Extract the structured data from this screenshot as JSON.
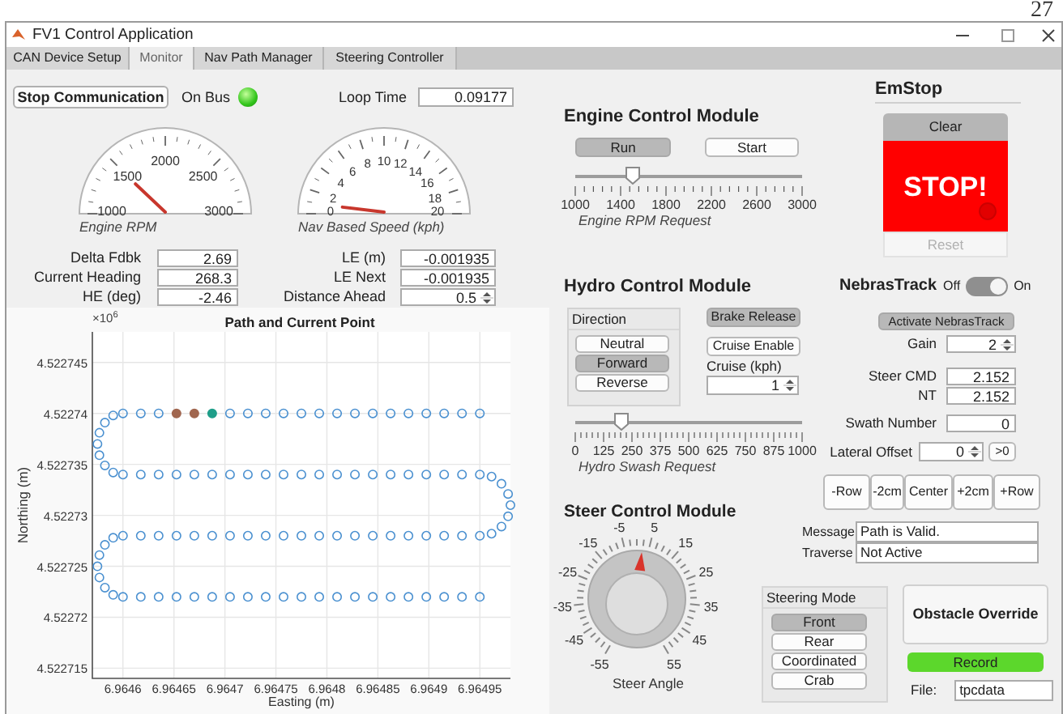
{
  "page_number": "27",
  "window": {
    "title": "FV1 Control Application"
  },
  "tabs": [
    {
      "label": "CAN Device Setup",
      "selected": false
    },
    {
      "label": "Monitor",
      "selected": true
    },
    {
      "label": "Nav Path Manager",
      "selected": false
    },
    {
      "label": "Steering Controller",
      "selected": false
    }
  ],
  "communication": {
    "button": "Stop Communication",
    "status_label": "On Bus",
    "on_bus": true,
    "loop_time_label": "Loop Time",
    "loop_time": "0.09177"
  },
  "gauges": [
    {
      "label": "Engine RPM",
      "ticks": [
        "1000",
        "1500",
        "2000",
        "2500",
        "3000"
      ]
    },
    {
      "label": "Nav Based Speed (kph)",
      "ticks": [
        "0",
        "2",
        "4",
        "6",
        "8",
        "10",
        "12",
        "14",
        "16",
        "18",
        "20"
      ]
    }
  ],
  "left_fields": [
    {
      "kind": "text",
      "label": "Delta Fdbk",
      "value": "2.69"
    },
    {
      "kind": "text",
      "label": "Current Heading",
      "value": "268.3"
    },
    {
      "kind": "text",
      "label": "HE (deg)",
      "value": "-2.46"
    }
  ],
  "right_fields": [
    {
      "kind": "text",
      "label": "LE (m)",
      "value": "-0.001935"
    },
    {
      "kind": "text",
      "label": "LE Next",
      "value": "-0.001935"
    },
    {
      "kind": "spinner",
      "label": "Distance Ahead",
      "value": "0.5"
    }
  ],
  "plot": {
    "y_exponent": "×10$^{6}$",
    "series_filled": [
      false,
      true,
      true
    ],
    "chart_data": {
      "type": "scatter",
      "title": "Path and Current Point",
      "xlabel": "Easting (m)",
      "ylabel": "Northing (m)",
      "grid": true,
      "xlim": [
        6.96457,
        6.96498
      ],
      "ylim": [
        4.522714,
        4.522748
      ],
      "xticks": [
        6.9646,
        6.96465,
        6.9647,
        6.96475,
        6.9648,
        6.96485,
        6.9649,
        6.96495
      ],
      "yticks": [
        4.522715,
        4.52272,
        4.522725,
        4.52273,
        4.522735,
        4.52274,
        4.522745
      ],
      "series": [
        {
          "color": "#4a90d0",
          "marker": "circle",
          "x": [
            6.9646175,
            6.964635,
            6.964705,
            6.9647225,
            6.96474,
            6.9647575,
            6.964775,
            6.9647925,
            6.96481,
            6.9648275,
            6.964845,
            6.9648625,
            6.96488,
            6.9648975,
            6.964915,
            6.9649325,
            6.96495,
            6.9646,
            6.9645904,
            6.9645823,
            6.9645769,
            6.964575,
            6.9645769,
            6.9645823,
            6.9645904,
            6.9646,
            6.9646175,
            6.964635,
            6.9646525,
            6.96467,
            6.9646875,
            6.964705,
            6.9647225,
            6.96474,
            6.9647575,
            6.964775,
            6.9647925,
            6.96481,
            6.9648275,
            6.964845,
            6.9648625,
            6.96488,
            6.9648975,
            6.964915,
            6.9649325,
            6.96495,
            6.9649615,
            6.9649712,
            6.9649777,
            6.96498,
            6.9649777,
            6.9649712,
            6.9649615,
            6.9646175,
            6.964635,
            6.9646525,
            6.96467,
            6.9646875,
            6.964705,
            6.9647225,
            6.96474,
            6.9647575,
            6.964775,
            6.9647925,
            6.96481,
            6.9648275,
            6.964845,
            6.9648625,
            6.96488,
            6.9648975,
            6.964915,
            6.9649325,
            6.96495,
            6.9646,
            6.9645904,
            6.9645823,
            6.9645769,
            6.964575,
            6.9645769,
            6.9645823,
            6.9645904,
            6.9646,
            6.9646175,
            6.964635,
            6.9646525,
            6.96467,
            6.9646875,
            6.964705,
            6.9647225,
            6.96474,
            6.9647575,
            6.964775,
            6.9647925,
            6.96481,
            6.9648275,
            6.964845,
            6.9648625,
            6.96488,
            6.9648975,
            6.964915,
            6.9649325,
            6.96495
          ],
          "values": [
            4.52274,
            4.52274,
            4.52274,
            4.52274,
            4.52274,
            4.52274,
            4.52274,
            4.52274,
            4.52274,
            4.52274,
            4.52274,
            4.52274,
            4.52274,
            4.52274,
            4.52274,
            4.52274,
            4.52274,
            4.52274,
            4.5227398,
            4.5227391,
            4.5227381,
            4.522737,
            4.5227359,
            4.5227349,
            4.5227342,
            4.522734,
            4.522734,
            4.522734,
            4.522734,
            4.522734,
            4.522734,
            4.522734,
            4.522734,
            4.522734,
            4.522734,
            4.522734,
            4.522734,
            4.522734,
            4.522734,
            4.522734,
            4.522734,
            4.522734,
            4.522734,
            4.522734,
            4.522734,
            4.522734,
            4.5227338,
            4.5227331,
            4.5227321,
            4.522731,
            4.5227299,
            4.5227289,
            4.5227282,
            4.522728,
            4.522728,
            4.522728,
            4.522728,
            4.522728,
            4.522728,
            4.522728,
            4.522728,
            4.522728,
            4.522728,
            4.522728,
            4.522728,
            4.522728,
            4.522728,
            4.522728,
            4.522728,
            4.522728,
            4.522728,
            4.522728,
            4.522728,
            4.522728,
            4.5227278,
            4.5227271,
            4.5227261,
            4.522725,
            4.5227239,
            4.5227229,
            4.5227222,
            4.522722,
            4.522722,
            4.522722,
            4.522722,
            4.522722,
            4.522722,
            4.522722,
            4.522722,
            4.522722,
            4.522722,
            4.522722,
            4.522722,
            4.522722,
            4.522722,
            4.522722,
            4.522722,
            4.522722,
            4.522722,
            4.522722,
            4.522722,
            4.522722
          ]
        },
        {
          "color": "#a0664f",
          "marker": "circle",
          "x": [
            6.9646525,
            6.96467
          ],
          "values": [
            4.52274,
            4.52274
          ]
        },
        {
          "color": "#1f9e89",
          "marker": "circle",
          "x": [
            6.9646875
          ],
          "values": [
            4.52274
          ]
        }
      ]
    }
  },
  "engine": {
    "title": "Engine Control Module",
    "buttons": [
      {
        "label": "Run",
        "selected": true
      },
      {
        "label": "Start",
        "selected": false
      }
    ],
    "slider": {
      "ticks": [
        "1000",
        "1400",
        "1800",
        "2200",
        "2600",
        "3000"
      ],
      "level": 0.25,
      "label": "Engine RPM Request"
    }
  },
  "emstop": {
    "title": "EmStop",
    "clear": "Clear",
    "stop": "STOP!",
    "reset": {
      "label": "Reset",
      "disabled": true
    }
  },
  "hydro": {
    "title": "Hydro Control Module",
    "direction": {
      "title": "Direction",
      "options": [
        {
          "label": "Neutral",
          "selected": false
        },
        {
          "label": "Forward",
          "selected": true
        },
        {
          "label": "Reverse",
          "selected": false
        }
      ]
    },
    "buttons": [
      {
        "label": "Brake Release",
        "selected": true
      },
      {
        "label": "Cruise Enable",
        "selected": false
      }
    ],
    "cruise_label": "Cruise (kph)",
    "cruise_value": "1",
    "slider": {
      "ticks": [
        "0",
        "125",
        "250",
        "375",
        "500",
        "625",
        "750",
        "875",
        "1000"
      ],
      "level": 0.2,
      "label": "Hydro Swash Request"
    }
  },
  "nebras": {
    "title": "NebrasTrack",
    "toggle": {
      "off_label": "Off",
      "on_label": "On",
      "on": true
    },
    "activate": {
      "label": "Activate NebrasTrack",
      "selected": true
    },
    "fields": [
      {
        "kind": "spinner",
        "label": "Gain",
        "value": "2"
      },
      {
        "kind": "text",
        "label": "Steer CMD",
        "value": "2.152"
      },
      {
        "kind": "text",
        "label": "NT",
        "value": "2.152"
      },
      {
        "kind": "text",
        "label": "Swath Number",
        "value": "0"
      },
      {
        "kind": "spinner_button",
        "label": "Lateral Offset",
        "value": "0",
        "button": ">0"
      }
    ],
    "offset_buttons": [
      "-Row",
      "-2cm",
      "Center",
      "+2cm",
      "+Row"
    ],
    "status": [
      {
        "label": "Message",
        "value": "Path is Valid."
      },
      {
        "label": "Traverse",
        "value": "Not Active"
      }
    ]
  },
  "steer": {
    "title": "Steer Control Module",
    "knob": {
      "ticks": [
        "-55",
        "-45",
        "-35",
        "-25",
        "-15",
        "-5",
        "5",
        "15",
        "25",
        "35",
        "45",
        "55"
      ],
      "label": "Steer Angle"
    }
  },
  "steering_mode": {
    "title": "Steering Mode",
    "options": [
      {
        "label": "Front",
        "selected": true
      },
      {
        "label": "Rear",
        "selected": false
      },
      {
        "label": "Coordinated",
        "selected": false
      },
      {
        "label": "Crab",
        "selected": false
      }
    ]
  },
  "obstacle_override": "Obstacle Override",
  "record": {
    "label": "Record",
    "on": true
  },
  "file": {
    "label": "File:",
    "value": "tpcdata"
  }
}
